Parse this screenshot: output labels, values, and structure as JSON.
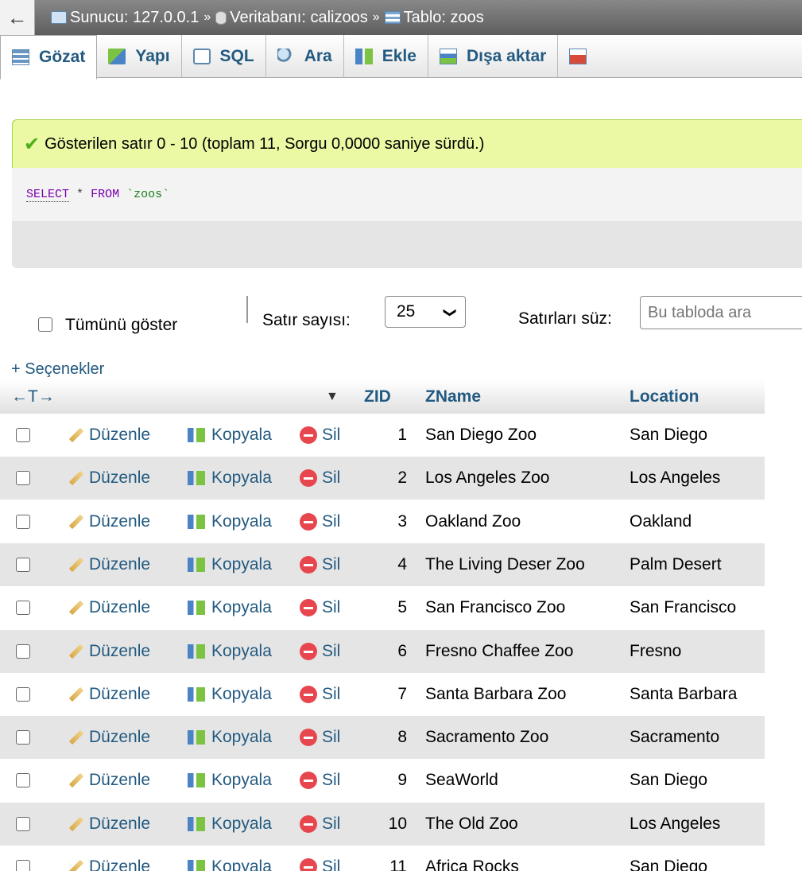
{
  "breadcrumb": {
    "back": "←",
    "server": "Sunucu: 127.0.0.1",
    "database": "Veritabanı: calizoos",
    "table": "Tablo: zoos",
    "sep": "»"
  },
  "tabs": [
    "Gözat",
    "Yapı",
    "SQL",
    "Ara",
    "Ekle",
    "Dışa aktar"
  ],
  "message": {
    "success": "Gösterilen satır 0 - 10 (toplam 11, Sorgu 0,0000 saniye sürdü.)",
    "check": "✔"
  },
  "sql": {
    "select": "SELECT",
    "star": "*",
    "from": "FROM",
    "table": "`zoos`"
  },
  "controls": {
    "show_all": "Tümünü göster",
    "rows_label": "Satır sayısı:",
    "rows_value": "25",
    "chevron": "❯",
    "filter_label": "Satırları süz:",
    "filter_placeholder": "Bu tabloda ara",
    "options": "+ Seçenekler"
  },
  "table": {
    "arrows": "←T→",
    "sort": "▼",
    "headers": [
      "ZID",
      "ZName",
      "Location"
    ],
    "actions": {
      "edit": "Düzenle",
      "copy": "Kopyala",
      "delete": "Sil"
    },
    "rows": [
      {
        "zid": "1",
        "zname": "San Diego Zoo",
        "location": "San Diego"
      },
      {
        "zid": "2",
        "zname": "Los Angeles Zoo",
        "location": "Los Angeles"
      },
      {
        "zid": "3",
        "zname": "Oakland Zoo",
        "location": "Oakland"
      },
      {
        "zid": "4",
        "zname": "The Living Deser Zoo",
        "location": "Palm Desert"
      },
      {
        "zid": "5",
        "zname": "San Francisco Zoo",
        "location": "San Francisco"
      },
      {
        "zid": "6",
        "zname": "Fresno Chaffee Zoo",
        "location": "Fresno"
      },
      {
        "zid": "7",
        "zname": "Santa Barbara Zoo",
        "location": "Santa Barbara"
      },
      {
        "zid": "8",
        "zname": "Sacramento Zoo",
        "location": "Sacramento"
      },
      {
        "zid": "9",
        "zname": "SeaWorld",
        "location": "San Diego"
      },
      {
        "zid": "10",
        "zname": "The Old Zoo",
        "location": "Los Angeles"
      },
      {
        "zid": "11",
        "zname": "Africa Rocks",
        "location": "San Diego"
      }
    ]
  }
}
